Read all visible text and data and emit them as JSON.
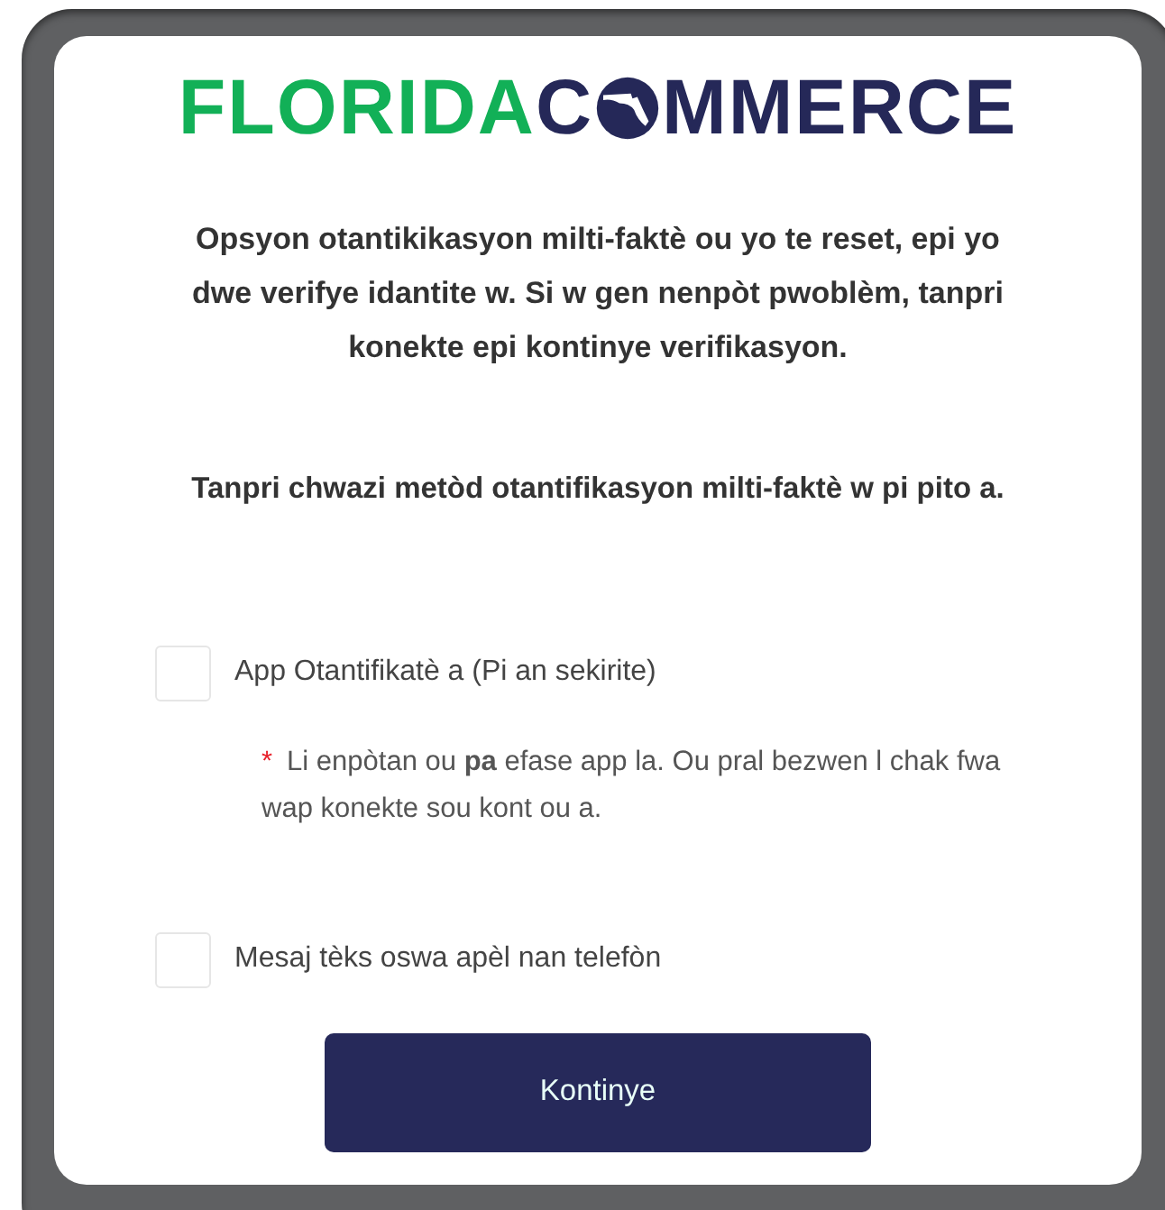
{
  "logo": {
    "part_1": "FLORIDA",
    "part_2": "C",
    "part_3": "MMERCE"
  },
  "intro": "Opsyon otantikikasyon milti-faktè ou yo te reset, epi yo dwe verifye idantite w. Si w gen nenpòt pwoblèm, tanpri konekte epi kontinye verifikasyon.",
  "prompt": "Tanpri chwazi metòd otantifikasyon milti-faktè w pi pito a.",
  "options": [
    {
      "label": "App Otantifikatè a (Pi an sekirite)",
      "checked": false,
      "note": {
        "marker": "*",
        "text": "Li enpòtan ou **pa** efase app la. Ou pral bezwen l chak fwa wap konekte sou kont ou a."
      }
    },
    {
      "label": "Mesaj tèks oswa apèl nan telefòn",
      "checked": false
    }
  ],
  "button": "Kontinye"
}
